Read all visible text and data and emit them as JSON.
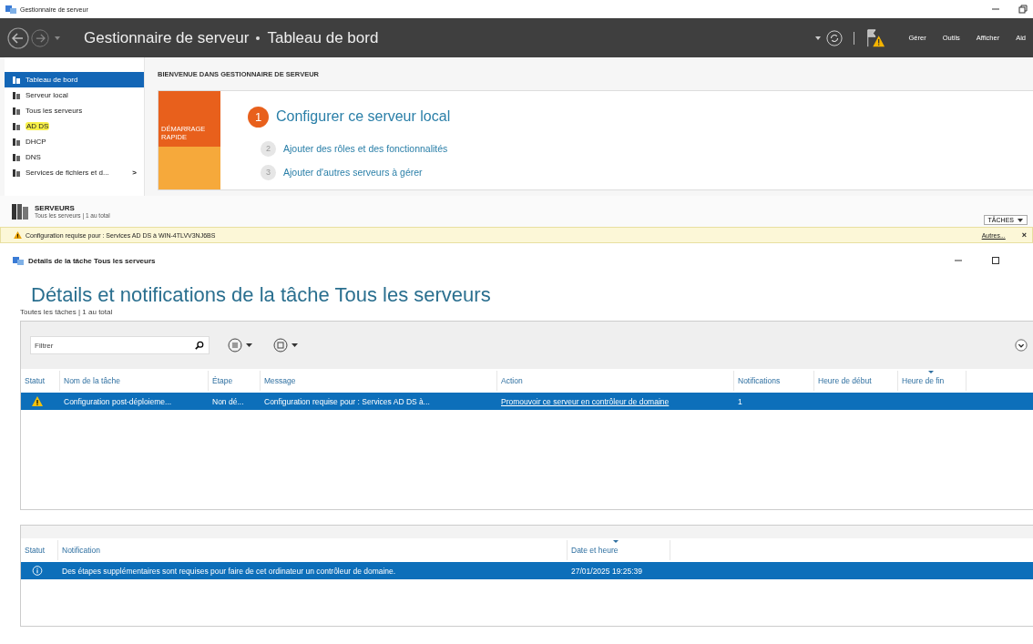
{
  "window": {
    "title": "Gestionnaire de serveur"
  },
  "header": {
    "breadcrumb": [
      "Gestionnaire de serveur",
      "Tableau de bord"
    ],
    "menu": [
      "Gérer",
      "Outils",
      "Afficher",
      "Aid"
    ]
  },
  "sidebar": {
    "items": [
      {
        "label": "Tableau de bord",
        "selected": true,
        "highlighted": false
      },
      {
        "label": "Serveur local",
        "selected": false,
        "highlighted": false
      },
      {
        "label": "Tous les serveurs",
        "selected": false,
        "highlighted": false
      },
      {
        "label": "AD DS",
        "selected": false,
        "highlighted": true
      },
      {
        "label": "DHCP",
        "selected": false,
        "highlighted": false
      },
      {
        "label": "DNS",
        "selected": false,
        "highlighted": false
      },
      {
        "label": "Services de fichiers et d...",
        "selected": false,
        "highlighted": false,
        "arrow": ">"
      }
    ]
  },
  "welcome": {
    "heading": "BIENVENUE DANS GESTIONNAIRE DE SERVEUR",
    "tile": "DÉMARRAGE RAPIDE",
    "steps": [
      {
        "number": "1",
        "label": "Configurer ce serveur local",
        "primary": true
      },
      {
        "number": "2",
        "label": "Ajouter des rôles et des fonctionnalités",
        "primary": false
      },
      {
        "number": "3",
        "label": "Ajouter d'autres serveurs à gérer",
        "primary": false
      }
    ]
  },
  "servers": {
    "title": "SERVEURS",
    "subtitle": "Tous les serveurs | 1 au total",
    "tasks_button": "TÂCHES"
  },
  "alert": {
    "message": "Configuration requise pour : Services AD DS à WIN-4TLVV3NJ6BS",
    "link": "Autres...",
    "close": "×"
  },
  "task_window": {
    "title": "Détails de la tâche Tous les serveurs",
    "heading": "Détails et notifications de la tâche Tous les serveurs",
    "subtitle": "Toutes les tâches | 1 au total",
    "filter": {
      "placeholder": "Filtrer"
    },
    "tasks": {
      "columns": [
        {
          "label": "Statut",
          "sorted": false
        },
        {
          "label": "Nom de la tâche",
          "sorted": false
        },
        {
          "label": "Étape",
          "sorted": false
        },
        {
          "label": "Message",
          "sorted": false
        },
        {
          "label": "Action",
          "sorted": false
        },
        {
          "label": "Notifications",
          "sorted": false
        },
        {
          "label": "Heure de début",
          "sorted": false
        },
        {
          "label": "Heure de fin",
          "sorted": true
        }
      ],
      "rows": [
        {
          "kind": "warning",
          "selected": true,
          "name": "Configuration post-déploieme...",
          "stage": "Non dé...",
          "message": "Configuration requise pour : Services AD DS à...",
          "action": "Promouvoir ce serveur en contrôleur de domaine",
          "notifications": "1"
        }
      ]
    },
    "notifications": {
      "columns": [
        {
          "label": "Statut",
          "sorted": false
        },
        {
          "label": "Notification",
          "sorted": false
        },
        {
          "label": "Date et heure",
          "sorted": true
        }
      ],
      "rows": [
        {
          "kind": "info",
          "selected": true,
          "text": "Des étapes supplémentaires sont requises pour faire de cet ordinateur un contrôleur de domaine.",
          "date": "27/01/2025 19:25:39"
        }
      ]
    }
  }
}
